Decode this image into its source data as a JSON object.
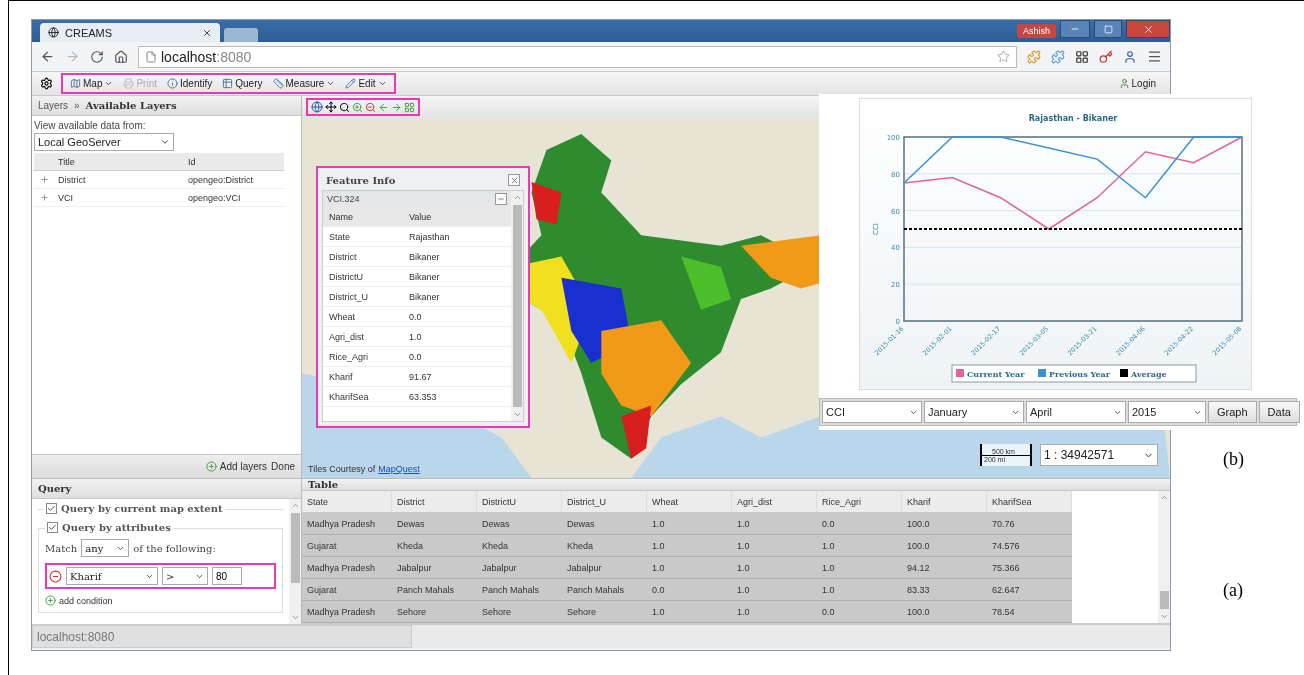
{
  "browser": {
    "tab_title": "CREAMS",
    "user": "Ashish",
    "url_host": "localhost",
    "url_port": ":8080"
  },
  "toolbar": {
    "items": [
      {
        "label": "Map",
        "kind": "map",
        "menu": true,
        "disabled": false
      },
      {
        "label": "Print",
        "kind": "print",
        "menu": false,
        "disabled": true
      },
      {
        "label": "Identify",
        "kind": "identify",
        "menu": false,
        "disabled": false
      },
      {
        "label": "Query",
        "kind": "query",
        "menu": false,
        "disabled": false
      },
      {
        "label": "Measure",
        "kind": "measure",
        "menu": true,
        "disabled": false
      },
      {
        "label": "Edit",
        "kind": "edit",
        "menu": true,
        "disabled": false
      }
    ],
    "login": "Login"
  },
  "layers": {
    "breadcrumb": "Layers",
    "separator": "»",
    "title": "Available Layers",
    "source_label": "View available data from:",
    "source": "Local GeoServer",
    "columns": [
      "Title",
      "Id"
    ],
    "rows": [
      {
        "title": "District",
        "id": "opengeo:District"
      },
      {
        "title": "VCI",
        "id": "opengeo:VCI"
      }
    ],
    "add_button": "Add layers",
    "done_button": "Done"
  },
  "map": {
    "attribution_prefix": "Tiles Courtesy of",
    "attribution_link": "MapQuest",
    "scale_km": "500 km",
    "scale_mi": "200 mi",
    "scale_ratio": "1 : 34942571"
  },
  "feature_info": {
    "title": "Feature Info",
    "feature": "VCI.324",
    "columns": [
      "Name",
      "Value"
    ],
    "rows": [
      {
        "name": "State",
        "value": "Rajasthan"
      },
      {
        "name": "District",
        "value": "Bikaner"
      },
      {
        "name": "DistrictU",
        "value": "Bikaner"
      },
      {
        "name": "District_U",
        "value": "Bikaner"
      },
      {
        "name": "Wheat",
        "value": "0.0"
      },
      {
        "name": "Agri_dist",
        "value": "1.0"
      },
      {
        "name": "Rice_Agri",
        "value": "0.0"
      },
      {
        "name": "Kharif",
        "value": "91.67"
      },
      {
        "name": "KharifSea",
        "value": "63.353"
      }
    ]
  },
  "chart_panel": {
    "chart_data": {
      "type": "line",
      "title": "Rajasthan - Bikaner",
      "ylabel": "CCI",
      "categories": [
        "2015-01-16",
        "2015-02-01",
        "2015-02-17",
        "2015-03-05",
        "2015-03-21",
        "2015-04-06",
        "2015-04-22",
        "2015-05-08"
      ],
      "series": [
        {
          "name": "Current Year",
          "color": "#e0649c",
          "line_style": "solid",
          "values": [
            75,
            78,
            67,
            50,
            67,
            92,
            86,
            100
          ]
        },
        {
          "name": "Previous Year",
          "color": "#3a92d4",
          "line_style": "solid",
          "values": [
            75,
            100,
            100,
            94,
            88,
            67,
            100,
            100
          ]
        },
        {
          "name": "Average",
          "color": "#000000",
          "line_style": "dashed",
          "values": [
            50,
            50,
            50,
            50,
            50,
            50,
            50,
            50
          ]
        }
      ],
      "ylim": [
        0,
        100
      ],
      "yticks": [
        0,
        20,
        40,
        60,
        80,
        100
      ],
      "grid": true,
      "legend": true
    },
    "selects": [
      "CCI",
      "January",
      "April",
      "2015"
    ],
    "buttons": [
      "Graph",
      "Data"
    ]
  },
  "query": {
    "title": "Query",
    "extent": {
      "label": "Query by current map extent",
      "checked": true
    },
    "attributes": {
      "label": "Query by attributes",
      "checked": true
    },
    "match_prefix": "Match",
    "match": "any",
    "match_suffix": "of the following:",
    "condition": {
      "field": "Kharif",
      "operator": ">",
      "value": "80"
    },
    "add": "add condition"
  },
  "table": {
    "title": "Table",
    "columns": [
      "State",
      "District",
      "DistrictU",
      "District_U",
      "Wheat",
      "Agri_dist",
      "Rice_Agri",
      "Kharif",
      "KharifSea"
    ],
    "rows": [
      {
        "selected": true,
        "cells": [
          "Madhya Pradesh",
          "Dewas",
          "Dewas",
          "Dewas",
          "1.0",
          "1.0",
          "0.0",
          "100.0",
          "70.76"
        ]
      },
      {
        "selected": true,
        "cells": [
          "Gujarat",
          "Kheda",
          "Kheda",
          "Kheda",
          "1.0",
          "1.0",
          "1.0",
          "100.0",
          "74.576"
        ]
      },
      {
        "selected": true,
        "cells": [
          "Madhya Pradesh",
          "Jabalpur",
          "Jabalpur",
          "Jabalpur",
          "1.0",
          "1.0",
          "1.0",
          "94.12",
          "75.366"
        ]
      },
      {
        "selected": true,
        "cells": [
          "Gujarat",
          "Panch Mahals",
          "Panch Mahals",
          "Panch Mahals",
          "0.0",
          "1.0",
          "1.0",
          "83.33",
          "62.647"
        ]
      },
      {
        "selected": true,
        "cells": [
          "Madhya Pradesh",
          "Sehore",
          "Sehore",
          "Sehore",
          "1.0",
          "1.0",
          "0.0",
          "100.0",
          "78.54"
        ]
      }
    ]
  },
  "status_bar": "localhost:8080",
  "panel_labels": [
    "(b)",
    "(a)"
  ]
}
